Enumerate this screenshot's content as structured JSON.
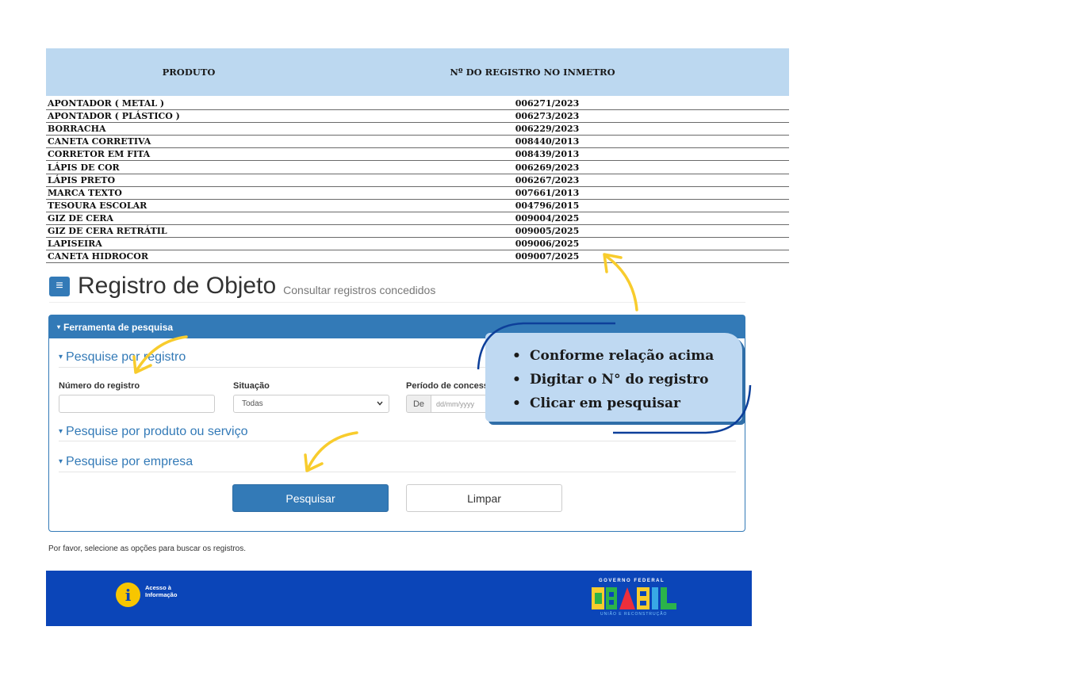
{
  "table": {
    "headers": {
      "produto": "PRODUTO",
      "registro": "Nº DO REGISTRO NO INMETRO"
    },
    "rows": [
      {
        "produto": "APONTADOR ( METAL )",
        "registro": "006271/2023"
      },
      {
        "produto": "APONTADOR ( PLÁSTICO )",
        "registro": "006273/2023"
      },
      {
        "produto": "BORRACHA",
        "registro": "006229/2023"
      },
      {
        "produto": "CANETA CORRETIVA",
        "registro": "008440/2013"
      },
      {
        "produto": "CORRETOR EM FITA",
        "registro": "008439/2013"
      },
      {
        "produto": "LÁPIS DE COR",
        "registro": "006269/2023"
      },
      {
        "produto": "LÁPIS PRETO",
        "registro": "006267/2023"
      },
      {
        "produto": "MARCA TEXTO",
        "registro": "007661/2013"
      },
      {
        "produto": "TESOURA ESCOLAR",
        "registro": "004796/2015"
      },
      {
        "produto": "GIZ DE CERA",
        "registro": "009004/2025"
      },
      {
        "produto": "GIZ DE CERA RETRÁTIL",
        "registro": "009005/2025"
      },
      {
        "produto": "LAPISEIRA",
        "registro": "009006/2025"
      },
      {
        "produto": "CANETA HIDROCOR",
        "registro": "009007/2025"
      }
    ]
  },
  "page": {
    "menu_icon": "≡",
    "title": "Registro de Objeto",
    "subtitle": "Consultar registros concedidos"
  },
  "panel": {
    "header": "Ferramenta de pesquisa",
    "caret": "▾",
    "sections": {
      "registro": "Pesquise por registro",
      "produto": "Pesquise por produto ou serviço",
      "empresa": "Pesquise por empresa"
    },
    "fields": {
      "numero_label": "Número do registro",
      "numero_value": "",
      "situacao_label": "Situação",
      "situacao_value": "Todas",
      "periodo_label": "Período de concess",
      "periodo_addon": "De",
      "periodo_placeholder": "dd/mm/yyyy"
    },
    "buttons": {
      "pesquisar": "Pesquisar",
      "limpar": "Limpar"
    }
  },
  "hint": "Por favor, selecione as opções para buscar os registros.",
  "footer": {
    "acesso_icon": "i",
    "acesso_line1": "Acesso à",
    "acesso_line2": "Informação",
    "gov_top": "GOVERNO FEDERAL",
    "gov_logo": "BRASIL",
    "gov_sub": "UNIÃO E RECONSTRUÇÃO"
  },
  "callout": {
    "items": [
      "Conforme relação acima",
      "Digitar o N° do registro",
      "Clicar em pesquisar"
    ]
  },
  "colors": {
    "primary": "#337ab7",
    "table_header": "#bcd8f0",
    "callout_bg": "#bfd9f2",
    "footer_bg": "#0b45b8",
    "arrow": "#f8cc2d",
    "callout_line": "#0d3f9a"
  }
}
